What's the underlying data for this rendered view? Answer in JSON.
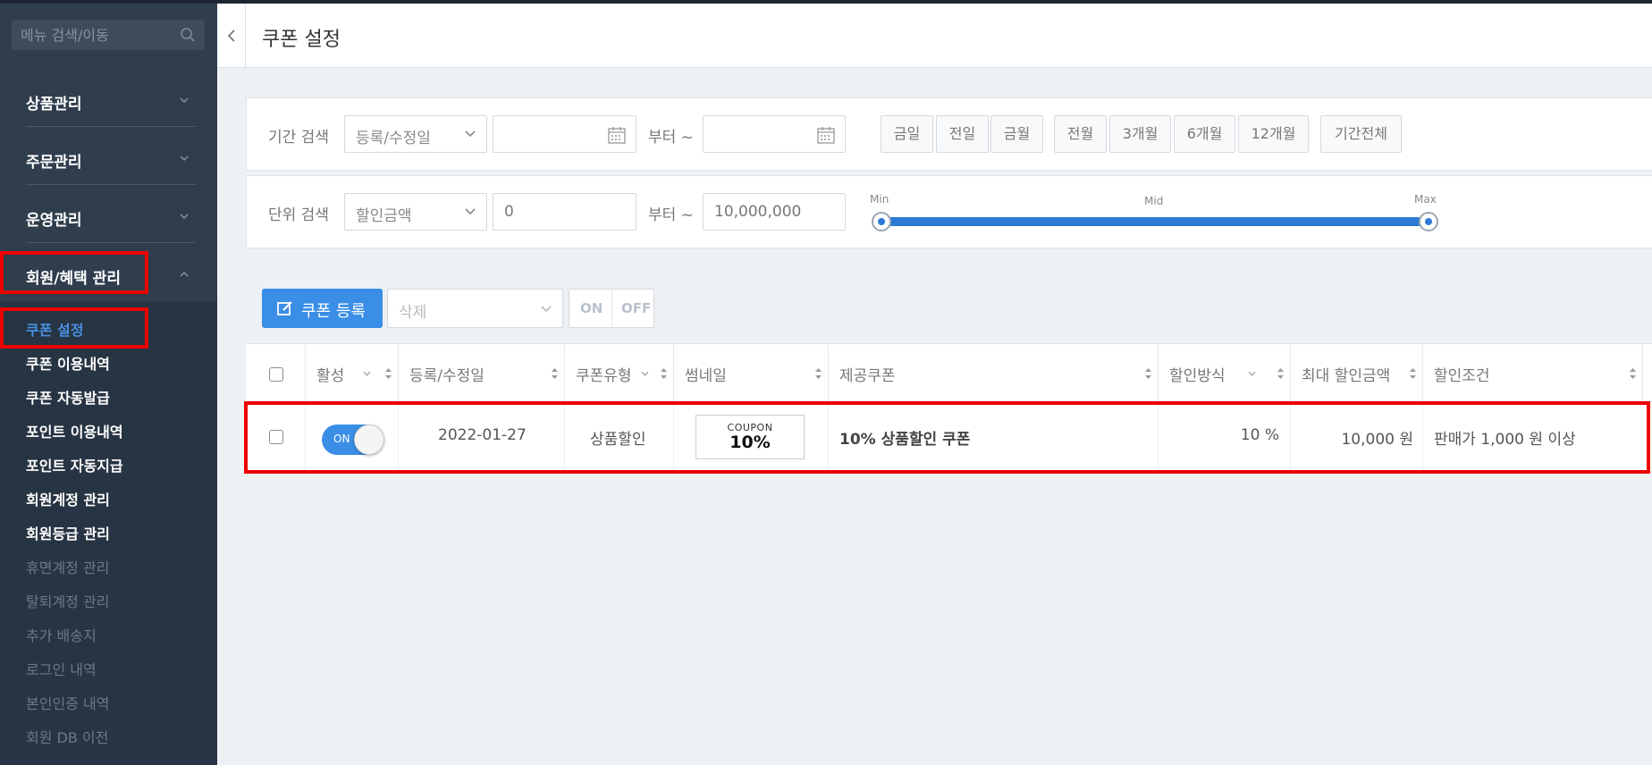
{
  "sidebar": {
    "search_placeholder": "메뉴 검색/이동",
    "groups": [
      {
        "label": "상품관리"
      },
      {
        "label": "주문관리"
      },
      {
        "label": "운영관리"
      },
      {
        "label": "회원/혜택 관리"
      }
    ],
    "submenu": [
      {
        "label": "쿠폰 설정"
      },
      {
        "label": "쿠폰 이용내역"
      },
      {
        "label": "쿠폰 자동발급"
      },
      {
        "label": "포인트 이용내역"
      },
      {
        "label": "포인트 자동지급"
      },
      {
        "label": "회원계정 관리"
      },
      {
        "label": "회원등급 관리"
      },
      {
        "label": "휴면계정 관리"
      },
      {
        "label": "탈퇴계정 관리"
      },
      {
        "label": "추가 배송지"
      },
      {
        "label": "로그인 내역"
      },
      {
        "label": "본인인증 내역"
      },
      {
        "label": "회원 DB 이전"
      }
    ]
  },
  "header": {
    "title": "쿠폰 설정"
  },
  "period_filter": {
    "label": "기간 검색",
    "select_value": "등록/수정일",
    "from_label": "부터 ~",
    "quick_buttons": [
      "금일",
      "전일",
      "금월",
      "전월",
      "3개월",
      "6개월",
      "12개월",
      "기간전체"
    ]
  },
  "unit_filter": {
    "label": "단위 검색",
    "select_value": "할인금액",
    "min_value": "0",
    "from_label": "부터 ~",
    "max_value": "10,000,000",
    "slider_labels": {
      "min": "Min",
      "mid": "Mid",
      "max": "Max"
    },
    "slider_range": [
      0,
      1
    ]
  },
  "toolbar": {
    "register_label": "쿠폰 등록",
    "delete_placeholder": "삭제",
    "on_label": "ON",
    "off_label": "OFF"
  },
  "table": {
    "headers": [
      "활성",
      "등록/수정일",
      "쿠폰유형",
      "썸네일",
      "제공쿠폰",
      "할인방식",
      "최대 할인금액",
      "할인조건"
    ],
    "rows": [
      {
        "active": "ON",
        "date": "2022-01-27",
        "type": "상품할인",
        "thumb_top": "COUPON",
        "thumb_main": "10%",
        "name": "10% 상품할인 쿠폰",
        "discount": "10 %",
        "max_discount": "10,000 원",
        "condition": "판매가 1,000 원 이상"
      }
    ]
  },
  "colors": {
    "accent": "#3a8ee6",
    "sidebar": "#2f3d4d",
    "highlight": "#ee0000"
  }
}
